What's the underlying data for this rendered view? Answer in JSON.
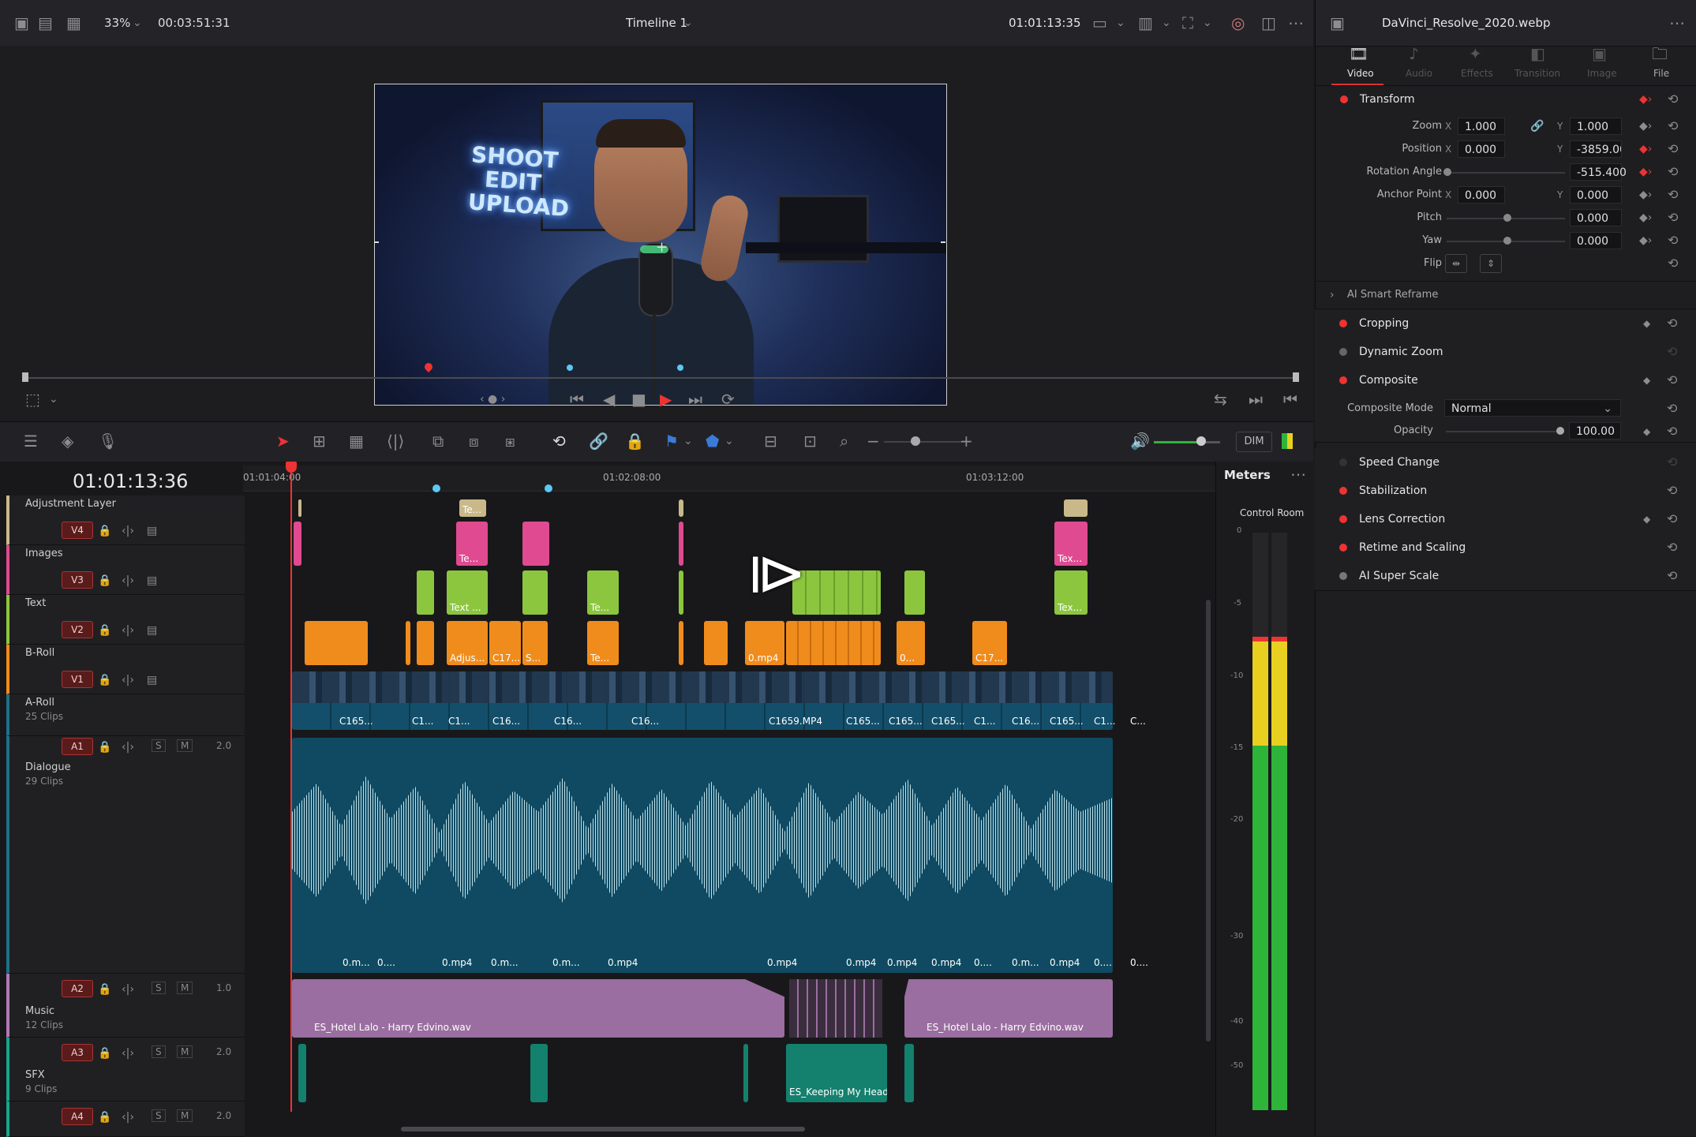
{
  "topbar": {
    "zoom": "33%",
    "timecode_left": "00:03:51:31",
    "timeline_name": "Timeline 1",
    "timecode_right": "01:01:13:35"
  },
  "toolbar": {
    "dim_label": "DIM"
  },
  "timeline": {
    "current_timecode": "01:01:13:36",
    "ruler_ticks": [
      "01:01:04:00",
      "01:02:08:00",
      "01:03:12:00"
    ],
    "tracks": [
      {
        "badge": "V4",
        "name": "Adjustment Layer",
        "sub": ""
      },
      {
        "badge": "V3",
        "name": "Images",
        "sub": ""
      },
      {
        "badge": "V2",
        "name": "Text",
        "sub": ""
      },
      {
        "badge": "V1",
        "name": "B-Roll",
        "sub": ""
      },
      {
        "badge": "A1",
        "name": "A-Roll",
        "sub": "25 Clips",
        "level": "2.0"
      },
      {
        "badge": "A2",
        "name": "Dialogue",
        "sub": "29 Clips",
        "level": "1.0"
      },
      {
        "badge": "A3",
        "name": "Music",
        "sub": "12 Clips",
        "level": "2.0"
      },
      {
        "badge": "A4",
        "name": "SFX",
        "sub": "9 Clips",
        "level": "2.0"
      }
    ],
    "clips": {
      "adjustment": [
        "Te..."
      ],
      "images": [
        "Te...",
        "Tex..."
      ],
      "text": [
        "Text ...",
        "Te...",
        "Tex..."
      ],
      "broll": [
        "Adjus...",
        "C17...",
        "S...",
        "Te...",
        "0.mp4",
        "0...",
        "C17..."
      ],
      "aroll": [
        "C165...",
        "C1...",
        "C1...",
        "C16...",
        "C16...",
        "C16...",
        "C1659.MP4",
        "C165...",
        "C165...",
        "C165...",
        "C1...",
        "C16...",
        "C165...",
        "C1...",
        "C..."
      ],
      "dialogue": [
        "0.m...",
        "0....",
        "0.mp4",
        "0.m...",
        "0.m...",
        "0.mp4",
        "0.mp4",
        "0.mp4",
        "0.mp4",
        "0.mp4",
        "0....",
        "0.m...",
        "0.mp4",
        "0....",
        "0...."
      ],
      "music": [
        "ES_Hotel Lalo - Harry Edvino.wav",
        "ES_Hotel Lalo - Harry Edvino.wav"
      ],
      "sfx": [
        "ES_Keeping My Head in th..."
      ]
    },
    "ab_labels": {
      "s": "S",
      "m": "M"
    }
  },
  "meters": {
    "title": "Meters",
    "subtitle": "Control Room",
    "scale": [
      "0",
      "-5",
      "-10",
      "-15",
      "-20",
      "-30",
      "-40",
      "-50"
    ],
    "level_fraction": 0.82
  },
  "inspector": {
    "filename": "DaVinci_Resolve_2020.webp",
    "tabs": [
      "Video",
      "Audio",
      "Effects",
      "Transition",
      "Image",
      "File"
    ],
    "transform": {
      "title": "Transform",
      "zoom_label": "Zoom",
      "zoom_x": "1.000",
      "zoom_y": "1.000",
      "position_label": "Position",
      "position_x": "0.000",
      "position_y": "-3859.000",
      "rotation_label": "Rotation Angle",
      "rotation": "-515.400",
      "anchor_label": "Anchor Point",
      "anchor_x": "0.000",
      "anchor_y": "0.000",
      "pitch_label": "Pitch",
      "pitch": "0.000",
      "yaw_label": "Yaw",
      "yaw": "0.000",
      "flip_label": "Flip",
      "x": "X",
      "y": "Y"
    },
    "smart_reframe": "AI Smart Reframe",
    "sections": [
      "Cropping",
      "Dynamic Zoom",
      "Composite"
    ],
    "composite": {
      "mode_label": "Composite Mode",
      "mode_value": "Normal",
      "opacity_label": "Opacity",
      "opacity_value": "100.00"
    },
    "sections2": [
      "Speed Change",
      "Stabilization",
      "Lens Correction",
      "Retime and Scaling",
      "AI Super Scale"
    ]
  },
  "viewer": {
    "neon_lines": [
      "SHOOT",
      "EDIT",
      "UPLOAD"
    ]
  }
}
